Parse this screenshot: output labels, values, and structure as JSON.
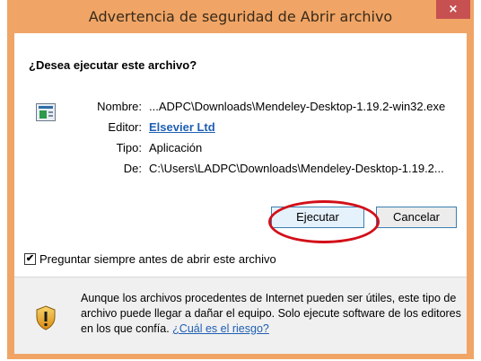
{
  "window": {
    "title": "Advertencia de seguridad de Abrir archivo",
    "close_glyph": "×"
  },
  "dialog": {
    "question": "¿Desea ejecutar este archivo?",
    "file_icon": "executable-file-icon",
    "details": [
      {
        "label": "Nombre:",
        "value": "...ADPC\\Downloads\\Mendeley-Desktop-1.19.2-win32.exe",
        "is_link": false
      },
      {
        "label": "Editor:",
        "value": "Elsevier Ltd",
        "is_link": true
      },
      {
        "label": "Tipo:",
        "value": "Aplicación",
        "is_link": false
      },
      {
        "label": "De:",
        "value": "C:\\Users\\LADPC\\Downloads\\Mendeley-Desktop-1.19.2...",
        "is_link": false
      }
    ],
    "buttons": {
      "run": "Ejecutar",
      "cancel": "Cancelar"
    },
    "checkbox": {
      "label": "Preguntar siempre antes de abrir este archivo",
      "checked": true,
      "check_glyph": "✔"
    },
    "warning": {
      "icon": "shield-warning-icon",
      "text": "Aunque los archivos procedentes de Internet pueden ser útiles, este tipo de archivo puede llegar a dañar el equipo. Solo ejecute software de los editores en los que confía. ",
      "link": "¿Cuál es el riesgo?"
    }
  },
  "colors": {
    "titlebar": "#f0a566",
    "close_button": "#c75050",
    "link": "#1f5fb3",
    "highlight_circle": "#d20f18"
  }
}
